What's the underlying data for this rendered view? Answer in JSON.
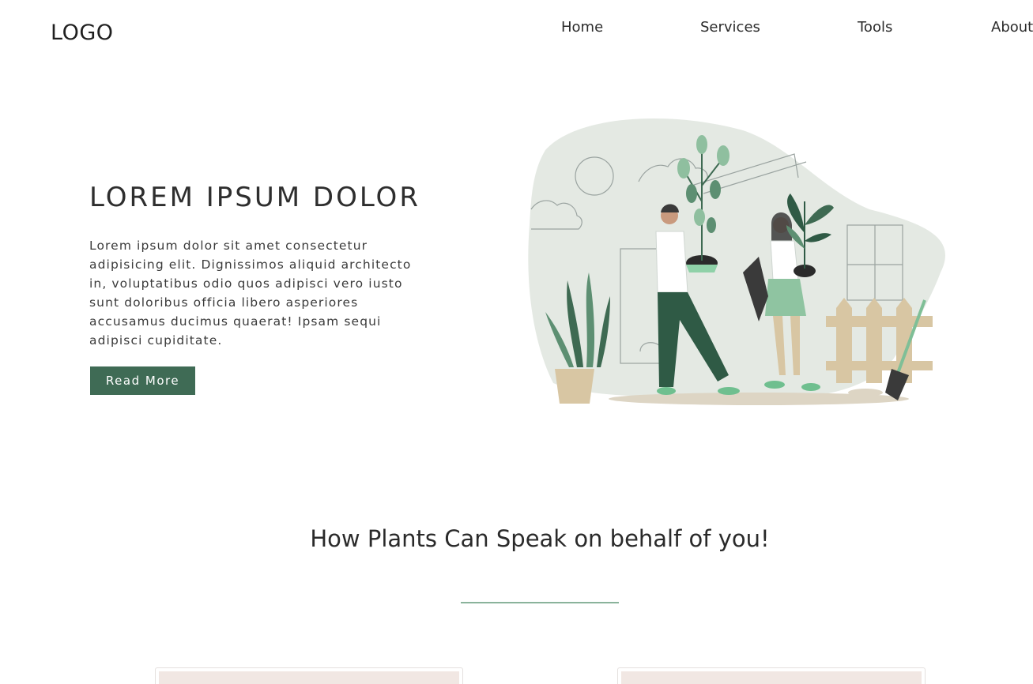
{
  "header": {
    "logo": "LOGO",
    "nav": [
      "Home",
      "Services",
      "Tools",
      "About"
    ]
  },
  "hero": {
    "title": "LOREM IPSUM DOLOR",
    "text_lines": [
      "Lorem ipsum dolor sit amet consectetur",
      "adipisicing elit. Dignissimos aliquid architecto",
      "in, voluptatibus odio quos adipisci vero iusto",
      "sunt doloribus officia libero asperiores",
      "accusamus ducimus quaerat! Ipsam sequi",
      "adipisci cupiditate."
    ],
    "button_label": "Read More"
  },
  "section": {
    "title": "How Plants Can Speak on behalf of you!"
  },
  "colors": {
    "accent": "#3f6b55",
    "divider": "#8ab39b",
    "blob": "#e4e9e3",
    "card_fill": "#f1e7e3"
  }
}
